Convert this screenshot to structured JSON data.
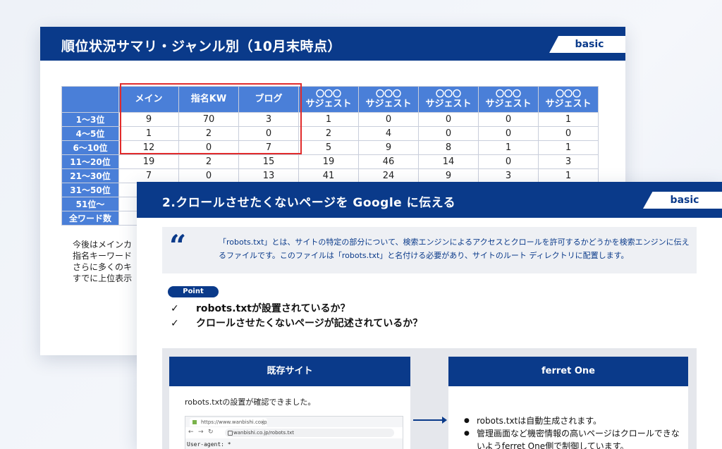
{
  "back_slide": {
    "title": "順位状況サマリ・ジャンル別（10月末時点）",
    "badge": "basic",
    "table": {
      "columns": [
        {
          "l1": "",
          "l2": "メイン"
        },
        {
          "l1": "",
          "l2": "指名KW"
        },
        {
          "l1": "",
          "l2": "ブログ"
        },
        {
          "l1": "〇〇〇",
          "l2": "サジェスト"
        },
        {
          "l1": "〇〇〇",
          "l2": "サジェスト"
        },
        {
          "l1": "〇〇〇",
          "l2": "サジェスト"
        },
        {
          "l1": "〇〇〇",
          "l2": "サジェスト"
        },
        {
          "l1": "〇〇〇",
          "l2": "サジェスト"
        }
      ],
      "rows": [
        {
          "label": "1～3位",
          "values": [
            "9",
            "70",
            "3",
            "1",
            "0",
            "0",
            "0",
            "1"
          ]
        },
        {
          "label": "4～5位",
          "values": [
            "1",
            "2",
            "0",
            "2",
            "4",
            "0",
            "0",
            "0"
          ]
        },
        {
          "label": "6～10位",
          "values": [
            "12",
            "0",
            "7",
            "5",
            "9",
            "8",
            "1",
            "1"
          ]
        },
        {
          "label": "11～20位",
          "values": [
            "19",
            "2",
            "15",
            "19",
            "46",
            "14",
            "0",
            "3"
          ]
        },
        {
          "label": "21～30位",
          "values": [
            "7",
            "0",
            "13",
            "41",
            "24",
            "9",
            "3",
            "1"
          ]
        },
        {
          "label": "31～50位",
          "values": [
            "",
            "",
            "",
            "",
            "",
            "",
            "",
            ""
          ]
        },
        {
          "label": "51位～",
          "values": [
            "",
            "",
            "",
            "",
            "",
            "",
            "",
            ""
          ]
        },
        {
          "label": "全ワード数",
          "values": [
            "",
            "",
            "",
            "",
            "",
            "",
            "",
            ""
          ]
        }
      ]
    },
    "note_lines": [
      "今後はメインカ",
      "指名キーワード",
      "さらに多くのキ",
      "すでに上位表示"
    ]
  },
  "front_slide": {
    "title": "2.クロールさせたくないページを Google に伝える",
    "badge": "basic",
    "quote": "「robots.txt」とは、サイトの特定の部分について、検索エンジンによるアクセスとクロールを許可するかどうかを検索エンジンに伝えるファイルです。このファイルは「robots.txt」と名付ける必要があり、サイトのルート ディレクトリに配置します。",
    "point_label": "Point",
    "checks": [
      "robots.txtが設置されているか？",
      "クロールさせたくないページが記述されているか？"
    ],
    "left_panel": {
      "title": "既存サイト",
      "text": "robots.txtの設置が確認できました。",
      "browser_tab": "https://www.wanbishi.co.jp/robo",
      "browser_url": "wanbishi.co.jp/robots.txt",
      "code": "User-agent: *"
    },
    "right_panel": {
      "title": "ferret One",
      "bullets": [
        "robots.txtは自動生成されます。",
        "管理画面など機密情報の高いページはクロールできないようferret One側で制御しています。"
      ]
    }
  }
}
